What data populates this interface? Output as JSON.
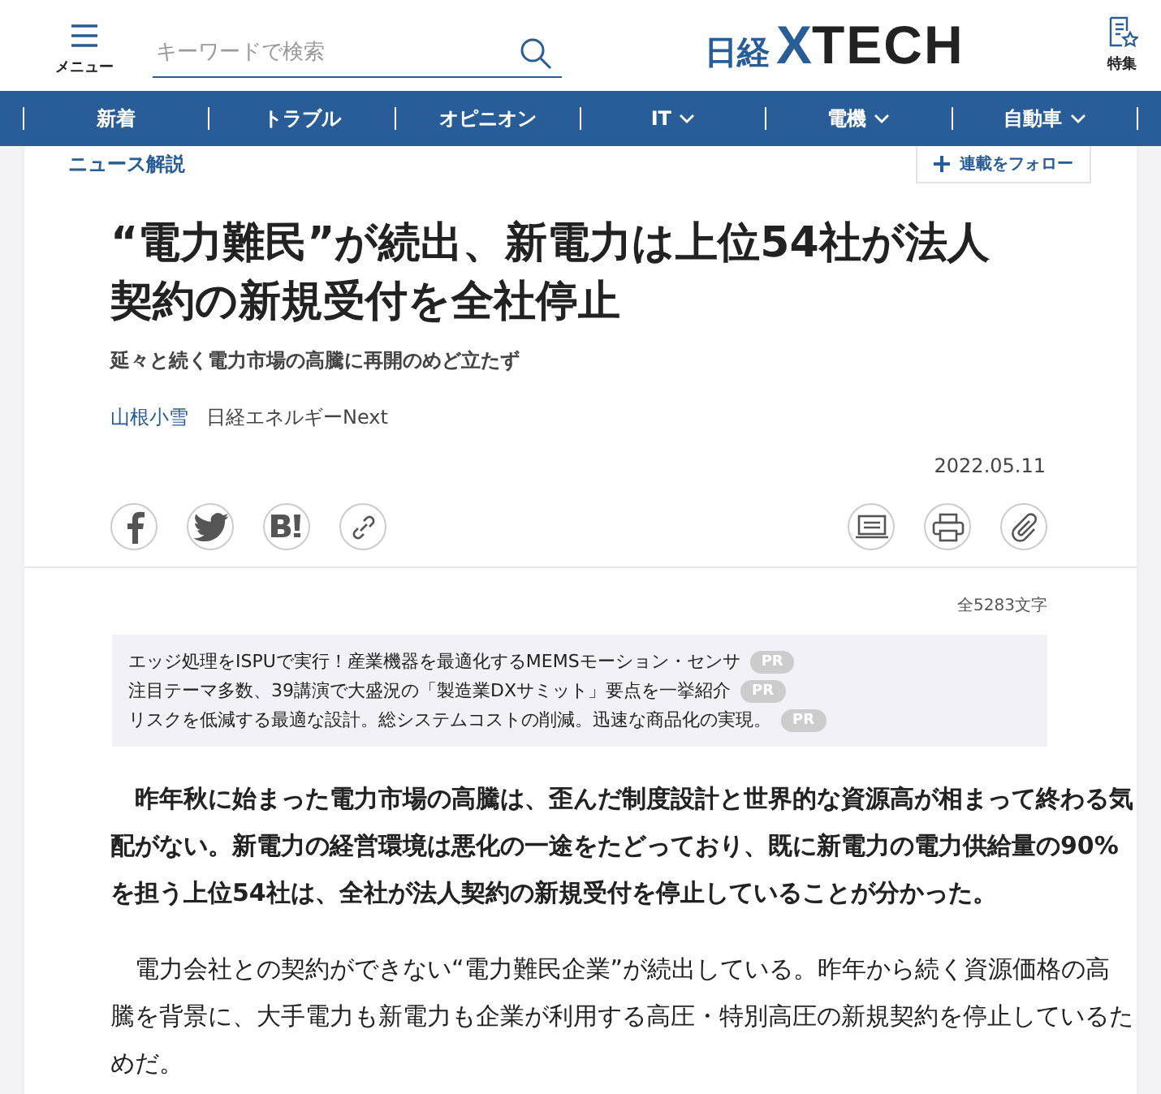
{
  "header": {
    "menu_label": "メニュー",
    "search": {
      "placeholder": "キーワードで検索"
    },
    "logo": {
      "prefix": "日経",
      "mark": "X",
      "name": "TECH"
    },
    "special_label": "特集"
  },
  "nav": [
    {
      "label": "新着",
      "has_menu": false
    },
    {
      "label": "トラブル",
      "has_menu": false
    },
    {
      "label": "オピニオン",
      "has_menu": false
    },
    {
      "label": "IT",
      "has_menu": true
    },
    {
      "label": "電機",
      "has_menu": true
    },
    {
      "label": "自動車",
      "has_menu": true
    }
  ],
  "article": {
    "category": "ニュース解説",
    "follow_button": "連載をフォロー",
    "title": "“電力難民”が続出、新電力は上位54社が法人契約の新規受付を全社停止",
    "subtitle": "延々と続く電力市場の高騰に再開のめど立たず",
    "author": "山根小雪",
    "publication": "日経エネルギーNext",
    "date": "2022.05.11",
    "char_count": "全5283文字",
    "ads": [
      {
        "text": "エッジ処理をISPUで実行！産業機器を最適化するMEMSモーション・センサ",
        "badge": "PR"
      },
      {
        "text": "注目テーマ多数、39講演で大盛況の「製造業DXサミット」要点を一挙紹介",
        "badge": "PR"
      },
      {
        "text": "リスクを低減する最適な設計。総システムコストの削減。迅速な商品化の実現。",
        "badge": "PR"
      }
    ],
    "paragraphs": [
      {
        "text": "昨年秋に始まった電力市場の高騰は、歪んだ制度設計と世界的な資源高が相まって終わる気配がない。新電力の経営環境は悪化の一途をたどっており、既に新電力の電力供給量の90%を担う上位54社は、全社が法人契約の新規受付を停止していることが分かった。",
        "bold": true
      },
      {
        "text": "電力会社との契約ができない“電力難民企業”が続出している。昨年から続く資源価格の高騰を背景に、大手電力も新電力も企業が利用する高圧・特別高圧の新規契約を停止しているためだ。",
        "bold": false
      }
    ]
  }
}
